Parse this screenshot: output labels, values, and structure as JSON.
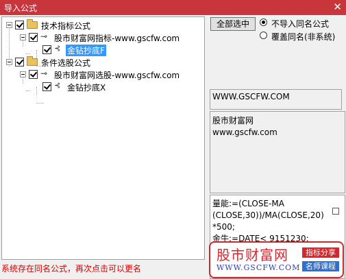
{
  "window": {
    "title": "导入公式",
    "close_label": "✕"
  },
  "tree": {
    "groups": [
      {
        "label": "技术指标公式",
        "checked": true,
        "child": {
          "label": "股市财富网指标-www.gscfw.com",
          "checked": true,
          "leaf": {
            "label": "金钻抄底F",
            "checked": true,
            "selected": true
          }
        }
      },
      {
        "label": "条件选股公式",
        "checked": true,
        "child": {
          "label": "股市财富网选股-www.gscfw.com",
          "checked": true,
          "leaf": {
            "label": "金钻抄底X",
            "checked": true,
            "selected": false
          }
        }
      }
    ]
  },
  "controls": {
    "select_all_label": "全部选中",
    "options": [
      {
        "label": "不导入同名公式",
        "checked": true
      },
      {
        "label": "覆盖同名(非系统)",
        "checked": false
      }
    ]
  },
  "info": {
    "url": "WWW.GSCFW.COM",
    "description_line1": "股市财富网",
    "description_line2": "www.gscfw.com",
    "code": "量能:=(CLOSE-MA\n(CLOSE,30))/MA(CLOSE,20)\n*500;\n金牛:=DATE< 9151230;"
  },
  "status": {
    "message": "系统存在同名公式，再次点击可以更名"
  },
  "watermark": {
    "name": "股市财富网",
    "url": "WWW.GSCFW.COM",
    "tag1": "指标分享",
    "tag2": "名师课程"
  },
  "colors": {
    "titlebar": "#c8353b",
    "selection": "#3399ff",
    "status_text": "#d60000",
    "brand_red": "#d8262c",
    "brand_blue": "#2f6fd0"
  }
}
